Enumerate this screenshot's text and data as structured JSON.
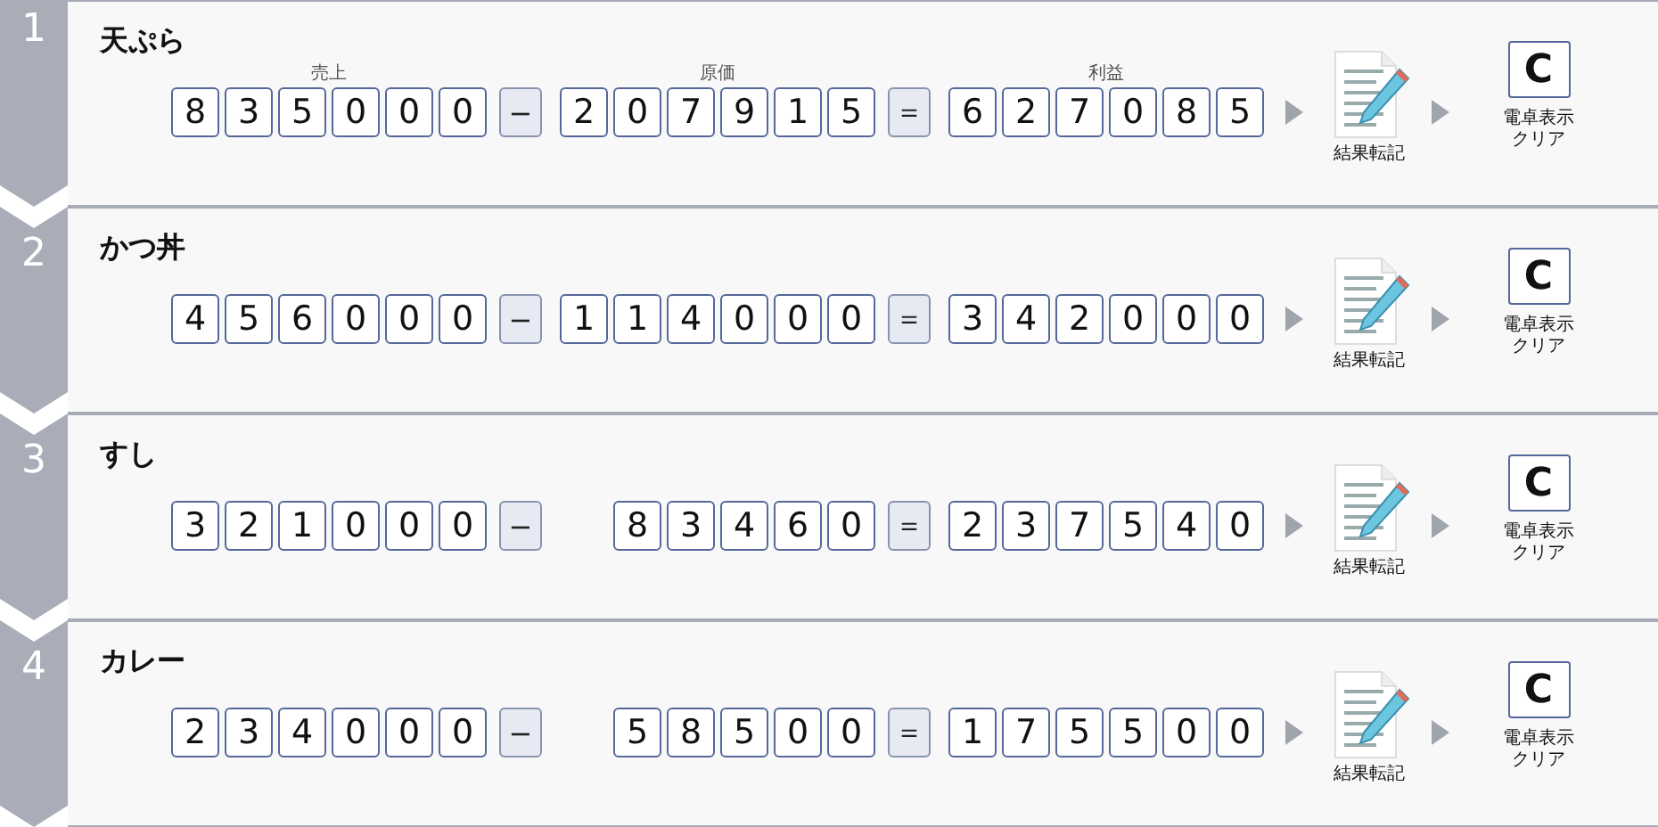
{
  "steps": [
    {
      "number": "1",
      "title": "天ぷら",
      "labels": [
        "売上",
        "原価",
        "利益"
      ],
      "sales": [
        "8",
        "3",
        "5",
        "0",
        "0",
        "0"
      ],
      "operator": "−",
      "cost": [
        "2",
        "0",
        "7",
        "9",
        "1",
        "5"
      ],
      "equals": "＝",
      "profit": [
        "6",
        "2",
        "7",
        "0",
        "8",
        "5"
      ],
      "memo_label": "結果転記",
      "clear_key": "C",
      "clear_label": [
        "電卓表示",
        "クリア"
      ]
    },
    {
      "number": "2",
      "title": "かつ丼",
      "sales": [
        "4",
        "5",
        "6",
        "0",
        "0",
        "0"
      ],
      "operator": "−",
      "cost": [
        "1",
        "1",
        "4",
        "0",
        "0",
        "0"
      ],
      "equals": "＝",
      "profit": [
        "3",
        "4",
        "2",
        "0",
        "0",
        "0"
      ],
      "memo_label": "結果転記",
      "clear_key": "C",
      "clear_label": [
        "電卓表示",
        "クリア"
      ]
    },
    {
      "number": "3",
      "title": "すし",
      "sales": [
        "3",
        "2",
        "1",
        "0",
        "0",
        "0"
      ],
      "operator": "−",
      "cost": [
        "8",
        "3",
        "4",
        "6",
        "0"
      ],
      "equals": "＝",
      "profit": [
        "2",
        "3",
        "7",
        "5",
        "4",
        "0"
      ],
      "memo_label": "結果転記",
      "clear_key": "C",
      "clear_label": [
        "電卓表示",
        "クリア"
      ]
    },
    {
      "number": "4",
      "title": "カレー",
      "sales": [
        "2",
        "3",
        "4",
        "0",
        "0",
        "0"
      ],
      "operator": "−",
      "cost": [
        "5",
        "8",
        "5",
        "0",
        "0"
      ],
      "equals": "＝",
      "profit": [
        "1",
        "7",
        "5",
        "5",
        "0",
        "0"
      ],
      "memo_label": "結果転記",
      "clear_key": "C",
      "clear_label": [
        "電卓表示",
        "クリア"
      ]
    }
  ]
}
